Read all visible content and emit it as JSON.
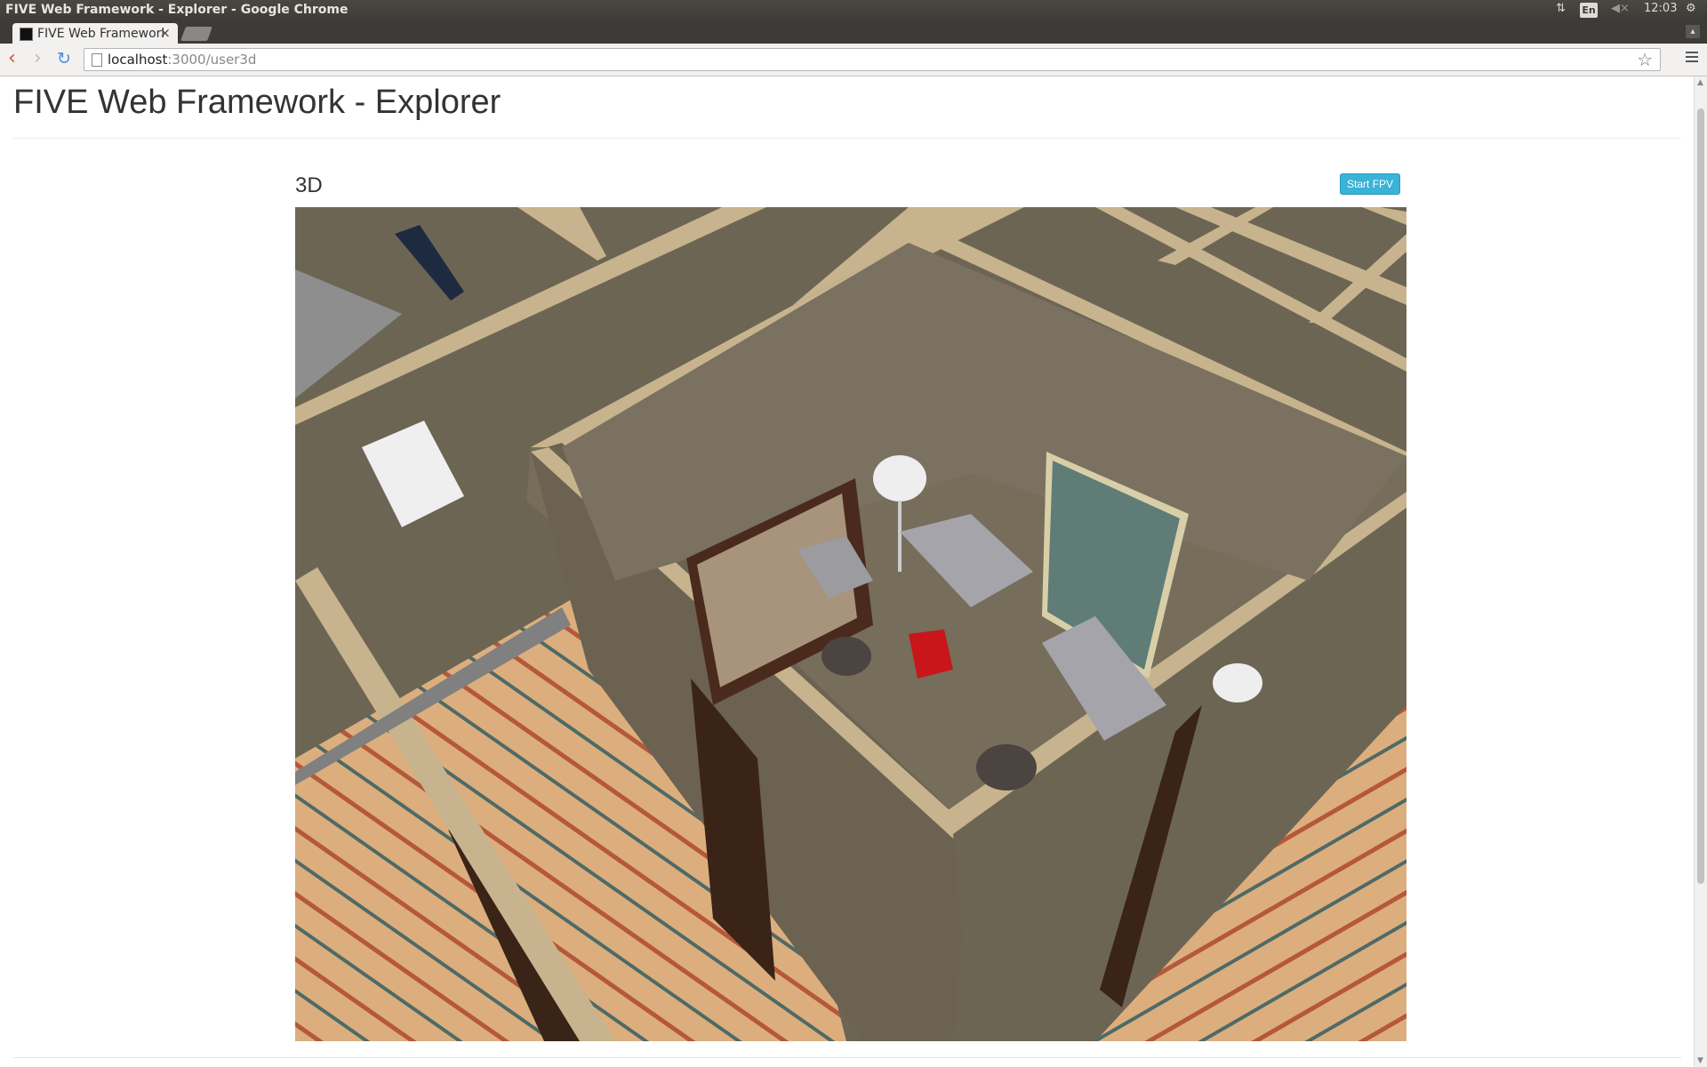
{
  "os": {
    "window_title": "FIVE Web Framework - Explorer - Google Chrome",
    "keyboard_layout": "En",
    "clock": "12:03",
    "icons": [
      "network-arrows-icon",
      "keyboard-layout-icon",
      "volume-muted-icon",
      "settings-gear-icon"
    ]
  },
  "browser": {
    "tab_title": "FIVE Web Framework - Explorer",
    "tab_close": "×",
    "url_host": "localhost",
    "url_path": ":3000/user3d"
  },
  "page": {
    "title": "FIVE Web Framework - Explorer",
    "section_label": "3D",
    "start_fpv_label": "Start FPV"
  },
  "colors": {
    "button_info": "#39b3d7",
    "wall": "#6f6656",
    "wall_trim": "#c7b48e",
    "floor": "#d9a877"
  }
}
